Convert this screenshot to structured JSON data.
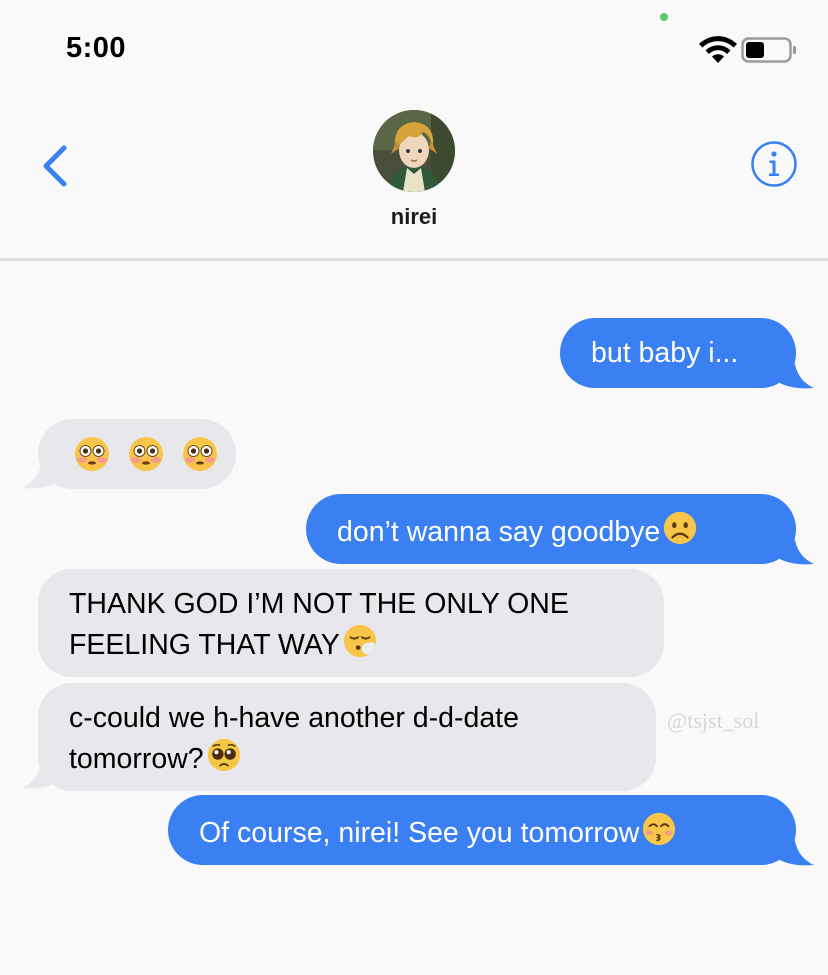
{
  "status_bar": {
    "time": "5:00"
  },
  "header": {
    "contact_name": "nirei"
  },
  "messages": [
    {
      "side": "sent",
      "text": "but baby i..."
    },
    {
      "side": "received",
      "text": "",
      "emoji": [
        "flushed-face",
        "flushed-face",
        "flushed-face"
      ]
    },
    {
      "side": "sent",
      "text": "don’t wanna say goodbye",
      "emoji": [
        "frowning-face"
      ]
    },
    {
      "side": "received",
      "lines": [
        "THANK GOD I’M NOT THE ONLY ONE",
        "FEELING THAT WAY"
      ],
      "emoji": [
        "face-exhaling"
      ]
    },
    {
      "side": "received",
      "lines": [
        "c-could we h-have another d-d-date",
        "tomorrow?"
      ],
      "emoji": [
        "pleading-face"
      ]
    },
    {
      "side": "sent",
      "text": "Of course, nirei! See you tomorrow",
      "emoji": [
        "kissing-face"
      ]
    }
  ],
  "watermark": "@tsjst_sol",
  "colors": {
    "sent_bubble": "#3a80f2",
    "received_bubble": "#e7e7ec",
    "accent": "#3a80f2",
    "background": "#f9f9fa"
  }
}
